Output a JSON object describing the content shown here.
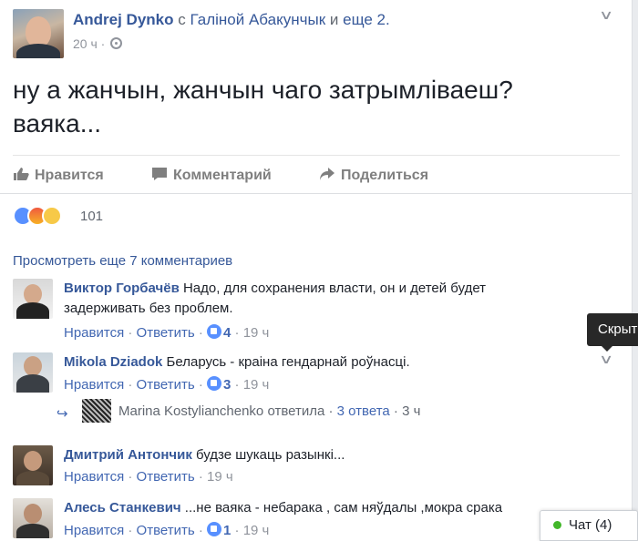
{
  "post": {
    "author": "Andrej Dynko",
    "with_word": "с",
    "tagged_person": "Галіной Абакунчык",
    "and_word": "и",
    "others": "еще 2",
    "dot": ".",
    "time": "20 ч",
    "separator": "·",
    "text_line1": "ну а жанчын, жанчын чаго затрымліваеш?",
    "text_line2": "ваяка..."
  },
  "actions": {
    "like": "Нравится",
    "comment": "Комментарий",
    "share": "Поделиться"
  },
  "reactions": {
    "count": "101"
  },
  "view_more": "Просмотреть еще 7 комментариев",
  "comment_actions": {
    "like": "Нравится",
    "reply": "Ответить"
  },
  "comments": [
    {
      "name": "Виктор Горбачёв",
      "text": "Надо, для сохранения власти, он и детей будет задерживать без проблем.",
      "likes": "4",
      "time": "19 ч"
    },
    {
      "name": "Mikola Dziadok",
      "text": "Беларусь - краіна гендарнай роўнасці.",
      "likes": "3",
      "time": "19 ч"
    },
    {
      "name": "Дмитрий Антончик",
      "text": "будзе шукаць разынкі...",
      "likes": "",
      "time": "19 ч"
    },
    {
      "name": "Алесь Станкевич",
      "text": "...не ваяка - небарака , сам няўдалы ,мокра срака",
      "likes": "1",
      "time": "19 ч"
    }
  ],
  "reply": {
    "name": "Marina Kostylianchenko",
    "verb": "ответила",
    "count": "3 ответа",
    "time": "3 ч"
  },
  "tooltip": "Скрыть",
  "chat": {
    "label": "Чат (4)"
  },
  "colors": {
    "link": "#365899",
    "muted": "#90949c",
    "online": "#42b72a",
    "like_blue": "#5890ff"
  }
}
